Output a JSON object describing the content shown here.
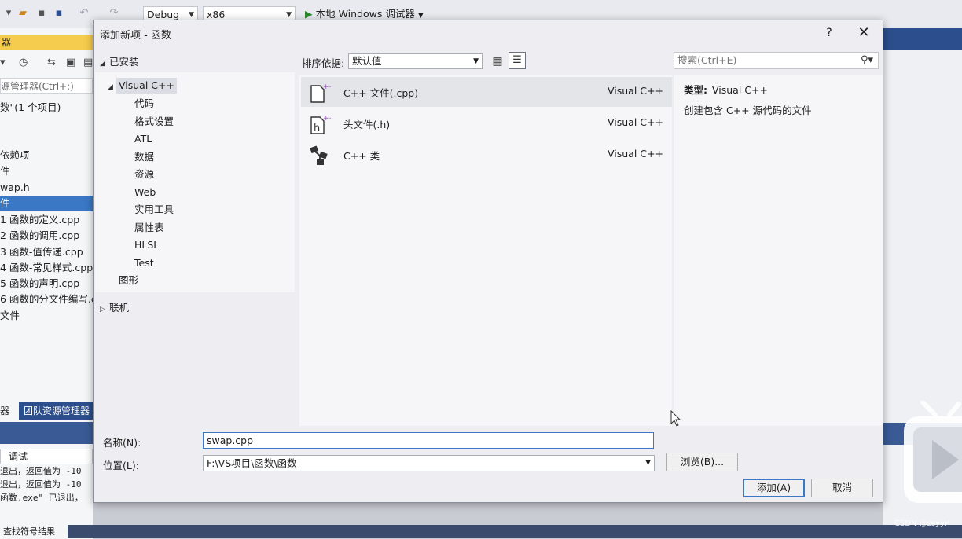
{
  "ide": {
    "config": "Debug",
    "platform": "x86",
    "run_label": "本地 Windows 调试器",
    "left_panel": {
      "header": "器",
      "search_placeholder": "源管理器(Ctrl+;)",
      "items": [
        "数\"(1 个项目)",
        "依赖项",
        "件",
        "wap.h",
        "件",
        "1 函数的定义.cpp",
        "2 函数的调用.cpp",
        "3 函数-值传递.cpp",
        "4 函数-常见样式.cpp",
        "5 函数的声明.cpp",
        "6 函数的分文件编写.cpp",
        "文件"
      ],
      "tabs": [
        "器",
        "团队资源管理器"
      ],
      "output_selector": "调试",
      "output_lines": [
        "退出，返回值为 -10",
        "退出，返回值为 -10",
        "函数.exe\" 已退出，"
      ]
    },
    "bottom_tab": "查找符号结果",
    "watermark": "CSDN @zsyyrl"
  },
  "dialog": {
    "title": "添加新项 - 函数",
    "help": "?",
    "close": "✕",
    "installed": "已安装",
    "tree": {
      "root": "Visual C++",
      "children": [
        "代码",
        "格式设置",
        "ATL",
        "数据",
        "资源",
        "Web",
        "实用工具",
        "属性表",
        "HLSL",
        "Test"
      ],
      "sibling": "图形"
    },
    "online": "联机",
    "sort_label": "排序依据:",
    "sort_value": "默认值",
    "search_placeholder": "搜索(Ctrl+E)",
    "templates": [
      {
        "name": "C++ 文件(.cpp)",
        "lang": "Visual C++"
      },
      {
        "name": "头文件(.h)",
        "lang": "Visual C++"
      },
      {
        "name": "C++ 类",
        "lang": "Visual C++"
      }
    ],
    "detail": {
      "type_label": "类型:",
      "type_value": "Visual C++",
      "description": "创建包含 C++ 源代码的文件"
    },
    "name_label": "名称(N):",
    "name_value": "swap.cpp",
    "location_label": "位置(L):",
    "location_value": "F:\\VS项目\\函数\\函数",
    "browse_button": "浏览(B)...",
    "add_button": "添加(A)",
    "cancel_button": "取消"
  }
}
